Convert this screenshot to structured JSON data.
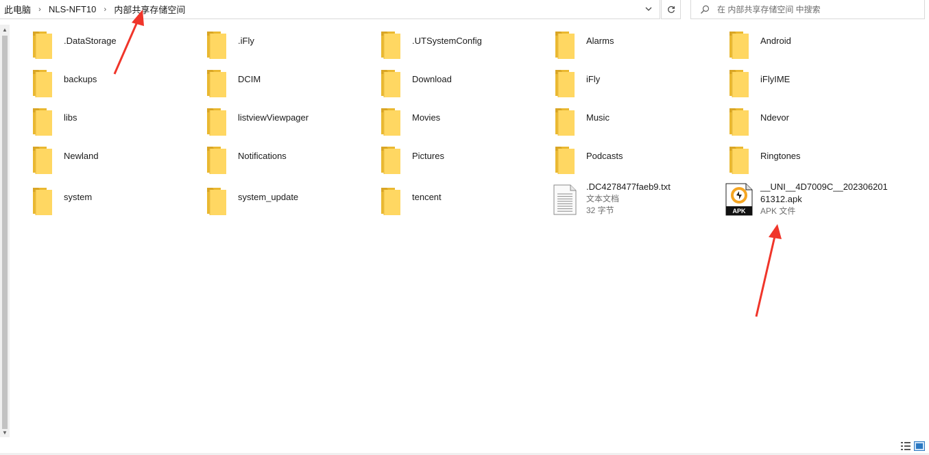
{
  "breadcrumb": [
    "此电脑",
    "NLS-NFT10",
    "内部共享存储空间"
  ],
  "search": {
    "placeholder": "在 内部共享存储空间 中搜索"
  },
  "folders": [
    ".DataStorage",
    ".iFly",
    ".UTSystemConfig",
    "Alarms",
    "Android",
    "backups",
    "DCIM",
    "Download",
    "iFly",
    "iFlyIME",
    "libs",
    "listviewViewpager",
    "Movies",
    "Music",
    "Ndevor",
    "Newland",
    "Notifications",
    "Pictures",
    "Podcasts",
    "Ringtones",
    "system",
    "system_update",
    "tencent"
  ],
  "files": [
    {
      "name": ".DC4278477faeb9.txt",
      "type": "文本文档",
      "size": "32 字节",
      "icon": "text-file-icon"
    },
    {
      "name": "__UNI__4D7009C__20230620161312.apk",
      "type": "APK 文件",
      "size": "",
      "icon": "apk-file-icon",
      "badge": "APK"
    }
  ],
  "colors": {
    "folder_front": "#ffd762",
    "folder_back": "#eab830",
    "annotation_arrow": "#f0352a",
    "apk_accent": "#f5a623"
  }
}
